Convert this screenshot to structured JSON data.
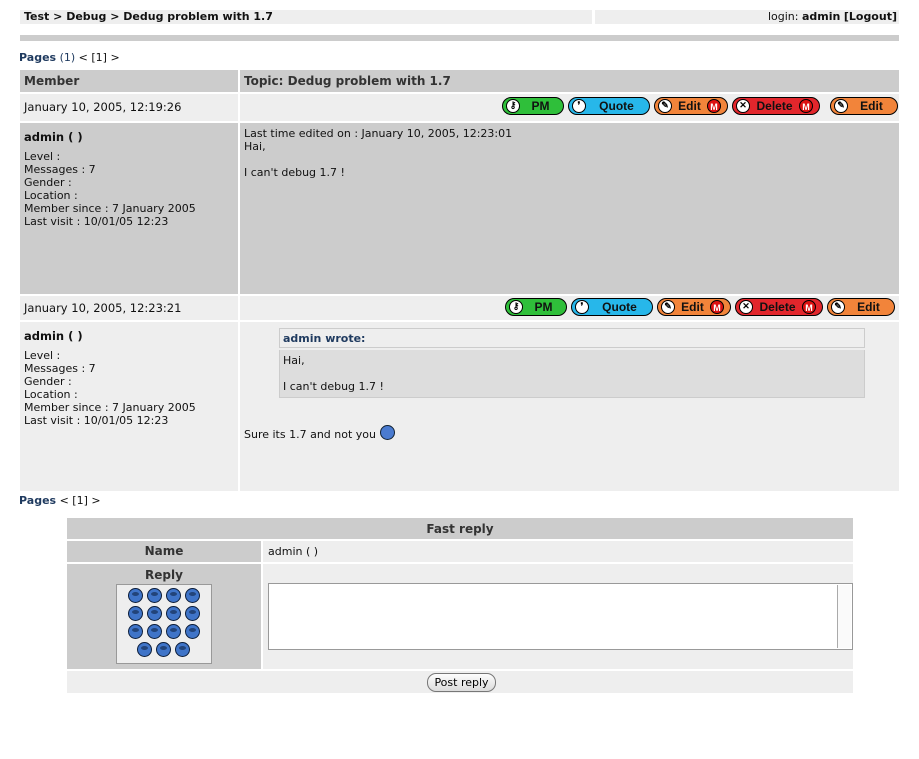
{
  "breadcrumb": [
    "Test",
    "Debug",
    "Dedug problem with 1.7"
  ],
  "breadcrumb_separator": ">",
  "login": {
    "label": "login:",
    "user": "admin",
    "logout": "[Logout]"
  },
  "pages_top": {
    "label": "Pages",
    "count": "(1)",
    "nav": "< [1] >"
  },
  "pages_bottom": {
    "label": "Pages",
    "nav": "< [1] >"
  },
  "table": {
    "member_header": "Member",
    "topic_header": "Topic: Dedug problem with 1.7"
  },
  "buttons": {
    "pm": "PM",
    "quote": "Quote",
    "edit": "Edit",
    "delete": "Delete",
    "mod_badge": "M"
  },
  "posts": [
    {
      "date": "January 10, 2005, 12:19:26",
      "member": {
        "name": "admin ( )",
        "level": "Level :",
        "messages": "Messages : 7",
        "gender": "Gender :",
        "location": "Location :",
        "member_since": "Member since : 7 January 2005",
        "last_visit": "Last visit : 10/01/05 12:23"
      },
      "edited": "Last time edited on : January 10, 2005, 12:23:01",
      "line1": "Hai,",
      "line2": "I can't debug 1.7 !"
    },
    {
      "date": "January 10, 2005, 12:23:21",
      "member": {
        "name": "admin ( )",
        "level": "Level :",
        "messages": "Messages : 7",
        "gender": "Gender :",
        "location": "Location :",
        "member_since": "Member since : 7 January 2005",
        "last_visit": "Last visit : 10/01/05 12:23"
      },
      "quote": {
        "header": "admin wrote:",
        "line1": "Hai,",
        "line2": "I can't debug 1.7 !"
      },
      "text": "Sure its 1.7 and not you"
    }
  ],
  "fast_reply": {
    "title": "Fast reply",
    "name_label": "Name",
    "name_value": "admin ( )",
    "reply_label": "Reply",
    "textarea_value": "",
    "submit": "Post reply"
  },
  "colors": {
    "header_gray": "#cccccc",
    "row_gray": "#eeeeee",
    "link_blue": "#1f3a5f"
  }
}
